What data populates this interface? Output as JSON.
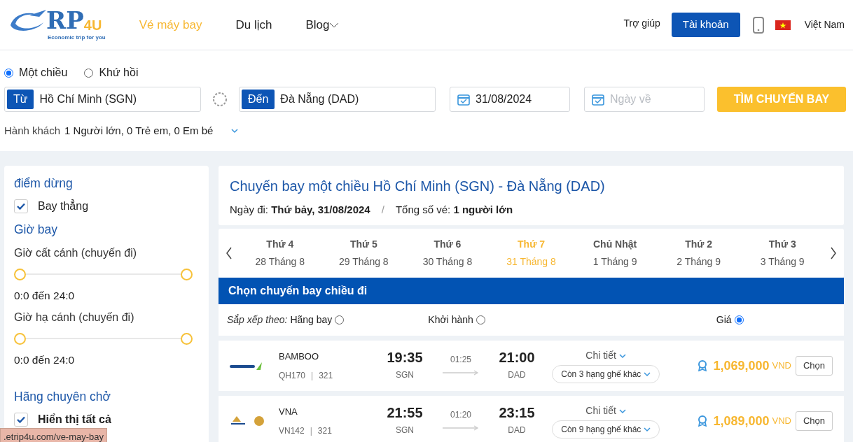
{
  "logo": {
    "mark": "RP",
    "accent": "4U",
    "tagline": "Economic trip for you"
  },
  "nav": [
    {
      "label": "Vé máy bay",
      "selected": true,
      "dropdown": false
    },
    {
      "label": "Du lịch",
      "selected": false,
      "dropdown": false
    },
    {
      "label": "Blog",
      "selected": false,
      "dropdown": true
    }
  ],
  "header_right": {
    "help": "Trợ giúp",
    "account_button": "Tài khoản",
    "language": "Việt Nam"
  },
  "trip_types": [
    {
      "label": "Một chiều",
      "selected": true
    },
    {
      "label": "Khứ hồi",
      "selected": false
    }
  ],
  "search": {
    "from_label": "Từ",
    "from_value": "Hồ Chí Minh (SGN)",
    "to_label": "Đến",
    "to_value": "Đà Nẵng (DAD)",
    "depart_date": "31/08/2024",
    "return_placeholder": "Ngày về",
    "button": "TÌM CHUYẾN BAY",
    "passengers_label": "Hành khách",
    "passengers_value": "1 Người lớn, 0 Trẻ em, 0 Em bé"
  },
  "filters": {
    "stops_title": "điểm dừng",
    "stops": [
      {
        "label": "Bay thẳng",
        "checked": true
      }
    ],
    "time_title": "Giờ bay",
    "time_sliders": [
      {
        "label": "Giờ cất cánh (chuyến đi)",
        "thumbs": [
          {
            "level": 0
          },
          {
            "level": 1
          }
        ],
        "reading": "0:0 đến 24:0"
      },
      {
        "label": "Giờ hạ cánh (chuyến đi)",
        "thumbs": [
          {
            "level": 0
          },
          {
            "level": 1
          }
        ],
        "reading": "0:0 đến 24:0"
      }
    ],
    "carrier_title": "Hãng chuyên chở",
    "carriers": [
      {
        "label": "Hiển thị tất cả",
        "checked": true
      }
    ]
  },
  "summary": {
    "title": "Chuyến bay một chiều Hồ Chí Minh (SGN) - Đà Nẵng (DAD)",
    "date_label": "Ngày đi:",
    "date_value": "Thứ bảy, 31/08/2024",
    "separator": "/",
    "total_label": "Tổng số vé:",
    "total_value": "1 người lớn"
  },
  "date_tabs": [
    {
      "day": "Thứ 4",
      "date": "28 Tháng 8",
      "selected": false
    },
    {
      "day": "Thứ 5",
      "date": "29 Tháng 8",
      "selected": false
    },
    {
      "day": "Thứ 6",
      "date": "30 Tháng 8",
      "selected": false
    },
    {
      "day": "Thứ 7",
      "date": "31 Tháng 8",
      "selected": true
    },
    {
      "day": "Chủ Nhật",
      "date": "1 Tháng 9",
      "selected": false
    },
    {
      "day": "Thứ 2",
      "date": "2 Tháng 9",
      "selected": false
    },
    {
      "day": "Thứ 3",
      "date": "3 Tháng 9",
      "selected": false
    }
  ],
  "section_title": "Chọn chuyến bay chiều đi",
  "sort": {
    "label": "Sắp xếp theo:",
    "options": [
      {
        "label": "Hãng bay",
        "selected": false
      },
      {
        "label": "Khởi hành",
        "selected": false
      },
      {
        "label": "Giá",
        "selected": true
      }
    ]
  },
  "flights": [
    {
      "airline": "BAMBOO",
      "kind": "bamboo",
      "code": "QH170",
      "separator": "|",
      "aircraft": "321",
      "depart_time": "19:35",
      "depart_airport": "SGN",
      "duration": "01:25",
      "arrive_time": "21:00",
      "arrive_airport": "DAD",
      "details": "Chi tiết",
      "classes": "Còn 3 hạng ghế khác",
      "price": "1,069,000",
      "currency": "VND",
      "select": "Chọn"
    },
    {
      "airline": "VNA",
      "kind": "vna",
      "code": "VN142",
      "separator": "|",
      "aircraft": "321",
      "depart_time": "21:55",
      "depart_airport": "SGN",
      "duration": "01:20",
      "arrive_time": "23:15",
      "arrive_airport": "DAD",
      "details": "Chi tiết",
      "classes": "Còn 9 hạng ghế khác",
      "price": "1,089,000",
      "currency": "VND",
      "select": "Chọn"
    }
  ],
  "status_bar": {
    "url": ".etrip4u.com/ve-may-bay"
  }
}
